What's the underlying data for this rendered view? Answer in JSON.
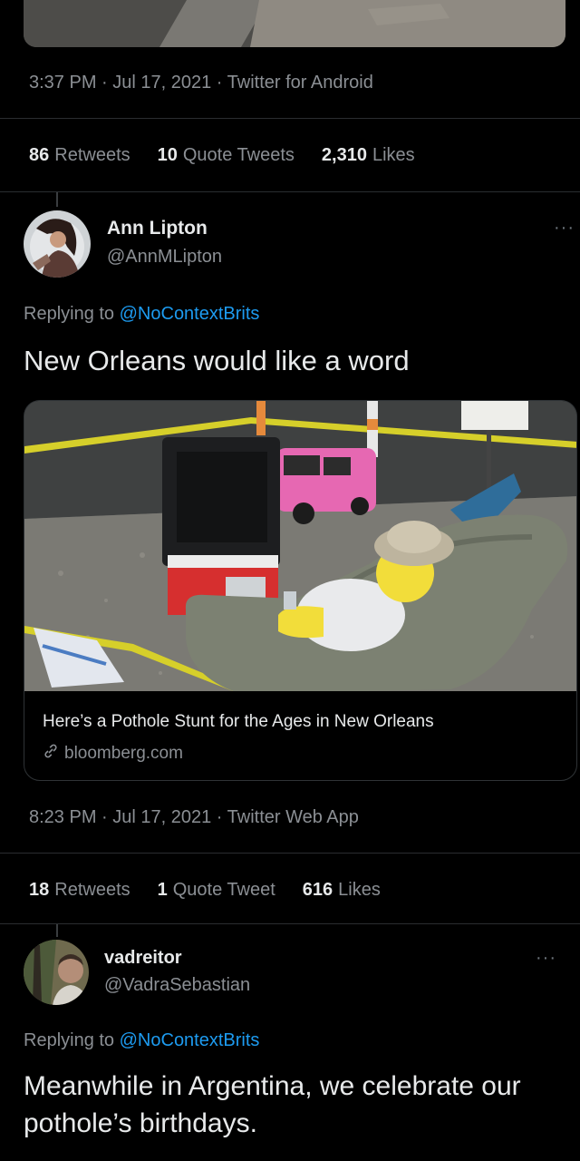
{
  "tweet1": {
    "timestamp": "3:37 PM · Jul 17, 2021 · Twitter for Android",
    "stats": {
      "retweets_count": "86",
      "retweets_label": "Retweets",
      "quotes_count": "10",
      "quotes_label": "Quote Tweets",
      "likes_count": "2,310",
      "likes_label": "Likes"
    }
  },
  "tweet2": {
    "name": "Ann Lipton",
    "handle": "@AnnMLipton",
    "more": "···",
    "replying_prefix": "Replying to",
    "replying_to": "@NoContextBrits",
    "text": "New Orleans would like a word",
    "card": {
      "title": "Here’s a Pothole Stunt for the Ages in New Orleans",
      "domain": "bloomberg.com"
    },
    "timestamp": "8:23 PM · Jul 17, 2021 · Twitter Web App",
    "stats": {
      "retweets_count": "18",
      "retweets_label": "Retweets",
      "quotes_count": "1",
      "quotes_label": "Quote Tweet",
      "likes_count": "616",
      "likes_label": "Likes"
    }
  },
  "tweet3": {
    "name": "vadreitor",
    "handle": "@VadraSebastian",
    "more": "···",
    "replying_prefix": "Replying to",
    "replying_to": "@NoContextBrits",
    "text": "Meanwhile in Argentina, we celebrate our pothole’s birthdays."
  },
  "icons": {
    "link": "link-icon",
    "more": "more-dots-icon"
  }
}
